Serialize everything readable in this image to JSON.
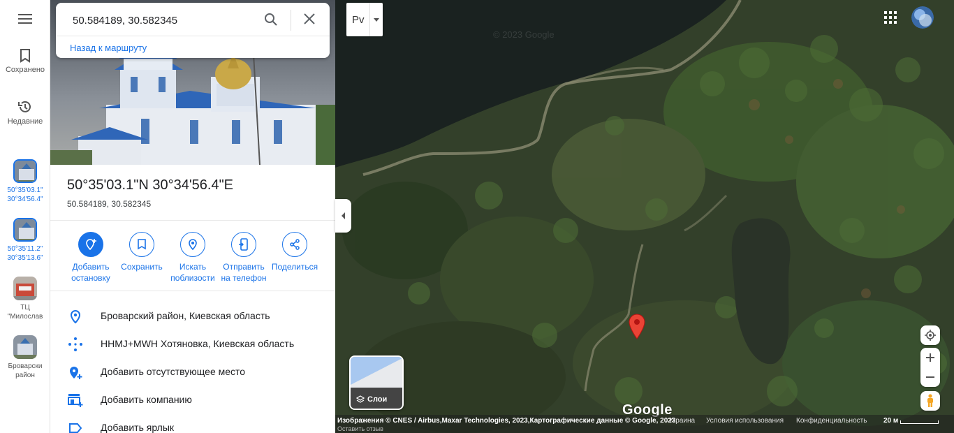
{
  "rail": {
    "saved_label": "Сохранено",
    "recent_label": "Недавние",
    "items": [
      {
        "line1": "50°35'03.1\"",
        "line2": "30°34'56.4\""
      },
      {
        "line1": "50°35'11.2\"",
        "line2": "30°35'13.6\""
      },
      {
        "line1": "ТЦ",
        "line2": "\"Милослав"
      },
      {
        "line1": "Броварски",
        "line2": "район"
      }
    ]
  },
  "search": {
    "value": "50.584189, 30.582345",
    "back_label": "Назад к маршруту"
  },
  "place": {
    "title": "50°35'03.1\"N 30°34'56.4\"E",
    "subtitle": "50.584189, 30.582345"
  },
  "actions": [
    {
      "line1": "Добавить",
      "line2": "остановку"
    },
    {
      "line1": "Сохранить",
      "line2": ""
    },
    {
      "line1": "Искать",
      "line2": "поблизости"
    },
    {
      "line1": "Отправить",
      "line2": "на телефон"
    },
    {
      "line1": "Поделиться",
      "line2": ""
    }
  ],
  "info": [
    {
      "icon": "location-pin-icon",
      "text": "Броварский район, Киевская область"
    },
    {
      "icon": "plus-code-icon",
      "text": "HHMJ+MWH Хотяновка, Киевская область"
    },
    {
      "icon": "add-place-icon",
      "text": "Добавить отсутствующее место"
    },
    {
      "icon": "add-business-icon",
      "text": "Добавить компанию"
    },
    {
      "icon": "label-icon",
      "text": "Добавить ярлык"
    }
  ],
  "map": {
    "lang_label": "Рv",
    "watermark": "© 2023 Google",
    "layers_label": "Слои",
    "logo": "Google",
    "footer": {
      "attribution": "Изображения © CNES / Airbus,Maxar Technologies, 2023,Картографические данные © Google, 2023",
      "country": "Украина",
      "terms": "Условия использования",
      "privacy": "Конфиденциальность",
      "scale": "20 м",
      "feedback": "Оставить отзыв"
    }
  },
  "colors": {
    "accent": "#1a73e8",
    "pin": "#ea4335"
  }
}
